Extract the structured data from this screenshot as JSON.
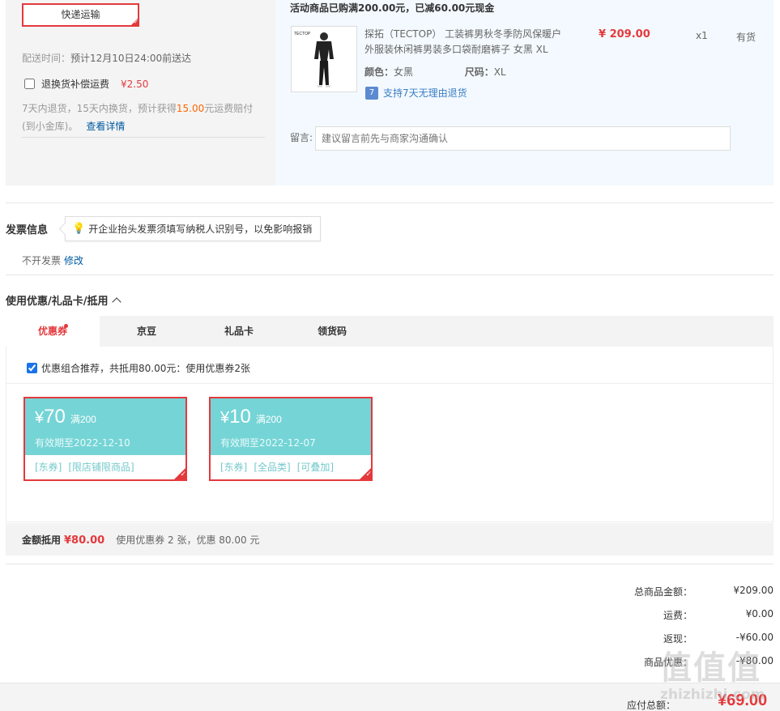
{
  "shipping": {
    "express_label": "快递运输",
    "date_label": "配送时间：",
    "date_value": "预计12月10日24:00前送达",
    "insurance_label": "退换货补偿运费",
    "insurance_price": "¥2.50",
    "desc_pre": "7天内退货，15天内换货，预计获得",
    "desc_amount": "15.00",
    "desc_post": "元运费赔付(到小金库)。",
    "detail_link": "查看详情"
  },
  "goods": {
    "promo": "活动商品已购满200.00元，已减60.00元现金",
    "thumb_brand": "TECTOP",
    "name": "探拓（TECTOP） 工装裤男秋冬季防风保暖户外服装休闲裤男装多口袋耐磨裤子 女黑 XL",
    "price": "¥ 209.00",
    "qty": "x1",
    "stock": "有货",
    "color_key": "颜色：",
    "color_val": "女黑",
    "size_key": "尺码：",
    "size_val": "XL",
    "return_icon": "7",
    "return_text": "支持7天无理由退货",
    "memo_label": "留言:",
    "memo_placeholder": "建议留言前先与商家沟通确认"
  },
  "invoice": {
    "title": "发票信息",
    "tip": "开企业抬头发票须填写纳税人识别号，以免影响报销",
    "value": "不开发票",
    "edit": "修改"
  },
  "discount": {
    "title": "使用优惠/礼品卡/抵用",
    "tabs": [
      "优惠券",
      "京豆",
      "礼品卡",
      "领货码"
    ],
    "recommend": "优惠组合推荐，共抵用80.00元：使用优惠券2张",
    "coupons": [
      {
        "currency": "¥",
        "amount": "70",
        "condition": "满200",
        "valid": "有效期至2022-12-10",
        "tags": [
          "[东券]",
          "[限店铺限商品]"
        ]
      },
      {
        "currency": "¥",
        "amount": "10",
        "condition": "满200",
        "valid": "有效期至2022-12-07",
        "tags": [
          "[东券]",
          "[全品类]",
          "[可叠加]"
        ]
      }
    ],
    "summary_label": "金额抵用",
    "summary_amount": "¥80.00",
    "summary_desc": "使用优惠券 2 张，优惠 80.00 元"
  },
  "totals": {
    "rows": [
      {
        "label": "总商品金额：",
        "value": "¥209.00"
      },
      {
        "label": "运费：",
        "value": "¥0.00"
      },
      {
        "label": "返现：",
        "value": "-¥60.00"
      },
      {
        "label": "商品优惠：",
        "value": "-¥80.00"
      }
    ],
    "pay_label": "应付总额：",
    "pay_value": "¥69.00"
  },
  "watermark": {
    "mark": "值值值",
    "site": "zhizhizhi.com"
  },
  "colors": {
    "accent": "#e4393c",
    "coupon": "#75d4d6",
    "link": "#005aa0"
  }
}
